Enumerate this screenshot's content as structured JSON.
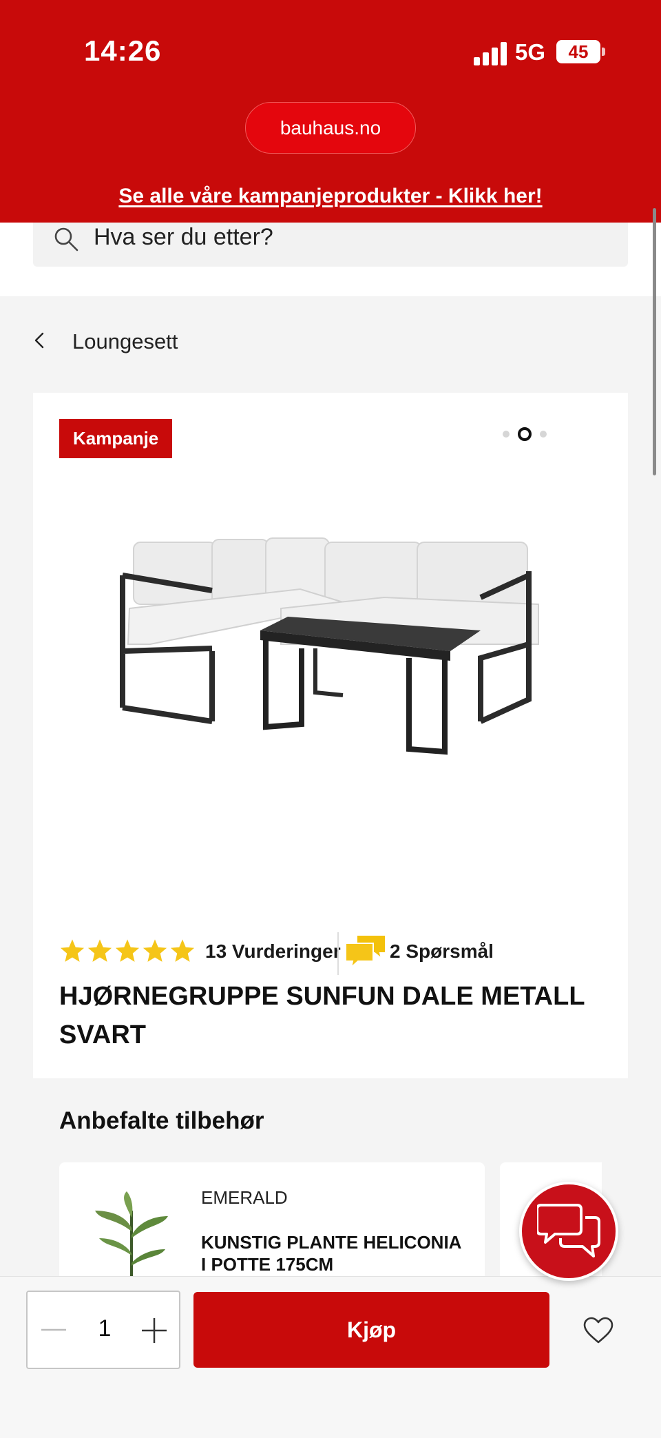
{
  "status_bar": {
    "time": "14:26",
    "network": "5G",
    "battery": "45"
  },
  "browser": {
    "url": "bauhaus.no"
  },
  "header": {
    "campaign_link": "Se alle våre kampanjeprodukter - Klikk her!",
    "accent_color": "#c80a0a"
  },
  "search": {
    "placeholder": "Hva ser du etter?",
    "icon": "search-icon"
  },
  "breadcrumb": {
    "label": "Loungesett",
    "icon": "chevron-left-icon"
  },
  "product": {
    "badge": "Kampanje",
    "carousel": {
      "count": 3,
      "active_index": 1
    },
    "rating": {
      "stars": 5,
      "reviews_label": "13 Vurderinger",
      "questions_label": "2 Spørsmål",
      "star_color": "#f5c518"
    },
    "title": "HJØRNEGRUPPE SUNFUN DALE METALL SVART"
  },
  "recommended": {
    "title": "Anbefalte tilbehør",
    "items": [
      {
        "brand": "EMERALD",
        "name": "KUNSTIG PLANTE HELICONIA I POTTE 175CM"
      }
    ]
  },
  "purchase": {
    "quantity": "1",
    "buy_label": "Kjøp"
  },
  "chat": {
    "icon": "chat-icon"
  }
}
